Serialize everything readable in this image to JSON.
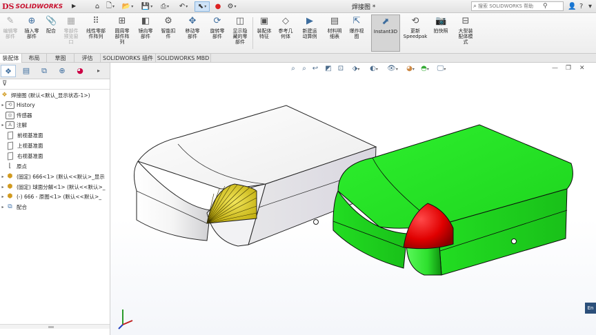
{
  "app": {
    "brand_ds": "DS",
    "brand_name": "SOLIDWORKS",
    "doc_title": "焊接图 *"
  },
  "quick_access": [
    "home-icon",
    "new-icon",
    "open-icon",
    "save-icon",
    "print-icon",
    "undo-icon",
    "select-icon",
    "rebuild-icon",
    "options-icon"
  ],
  "search": {
    "placeholder": "搜索 SOLIDWORKS 帮助"
  },
  "title_right": {
    "help": "?",
    "minimize": "—",
    "close": "×"
  },
  "commands": [
    {
      "label": "编辑零\n部件",
      "icon": "edit-component-icon",
      "disabled": true
    },
    {
      "label": "插入零\n部件",
      "icon": "insert-component-icon"
    },
    {
      "label": "配合",
      "icon": "mate-icon"
    },
    {
      "label": "零部件\n预览窗\n口",
      "icon": "preview-window-icon",
      "disabled": true
    },
    {
      "label": "线性零部\n件阵列",
      "icon": "linear-pattern-icon"
    },
    {
      "label": "圆周零\n部件阵\n列",
      "icon": "circular-pattern-icon"
    },
    {
      "label": "镜向零\n部件",
      "icon": "mirror-icon"
    },
    {
      "label": "智能扣\n件",
      "icon": "smart-fastener-icon"
    },
    {
      "label": "移动零\n部件",
      "icon": "move-component-icon"
    },
    {
      "label": "旋转零\n部件",
      "icon": "rotate-component-icon"
    },
    {
      "label": "显示隐\n藏的零\n部件",
      "icon": "show-hidden-icon"
    },
    {
      "label": "装配体\n特征",
      "icon": "assembly-feature-icon"
    },
    {
      "label": "参考几\n何体",
      "icon": "reference-geometry-icon"
    },
    {
      "label": "新建运\n动算例",
      "icon": "motion-study-icon"
    },
    {
      "label": "材料明\n细表",
      "icon": "bom-icon"
    },
    {
      "label": "爆炸视\n图",
      "icon": "exploded-view-icon"
    },
    {
      "label": "Instant3D",
      "icon": "instant3d-icon",
      "active": true
    },
    {
      "label": "更新\nSpeedpak",
      "icon": "speedpak-icon"
    },
    {
      "label": "拍快照",
      "icon": "snapshot-icon"
    },
    {
      "label": "大型装\n配体模\n式",
      "icon": "large-assembly-icon"
    }
  ],
  "tabs": [
    "装配体",
    "布局",
    "草图",
    "评估",
    "SOLIDWORKS 插件",
    "SOLIDWORKS MBD"
  ],
  "active_tab": 0,
  "panel_tabs": [
    "feature-manager-icon",
    "property-manager-icon",
    "configuration-manager-icon",
    "dimxpert-icon",
    "display-manager-icon"
  ],
  "tree": [
    {
      "label": "焊接图 (默认<默认_显示状态-1>)",
      "icon": "assembly-icon",
      "expand": "",
      "indent": 0
    },
    {
      "label": "History",
      "icon": "history-icon",
      "expand": "▸",
      "indent": 1
    },
    {
      "label": "传感器",
      "icon": "sensor-icon",
      "expand": "",
      "indent": 1
    },
    {
      "label": "注解",
      "icon": "annotation-icon",
      "expand": "▸",
      "indent": 1
    },
    {
      "label": "前视基准面",
      "icon": "plane-icon",
      "expand": "",
      "indent": 1
    },
    {
      "label": "上视基准面",
      "icon": "plane-icon",
      "expand": "",
      "indent": 1
    },
    {
      "label": "右视基准面",
      "icon": "plane-icon",
      "expand": "",
      "indent": 1
    },
    {
      "label": "原点",
      "icon": "origin-icon",
      "expand": "",
      "indent": 1
    },
    {
      "label": "(固定) 666<1> (默认<<默认>_显示",
      "icon": "part-icon",
      "expand": "▸",
      "indent": 1
    },
    {
      "label": "(固定) 球面分解<1> (默认<<默认>_",
      "icon": "part-icon",
      "expand": "▸",
      "indent": 1
    },
    {
      "label": "(-) 666 - 原图<1> (默认<<默认>_",
      "icon": "part-icon",
      "expand": "▸",
      "indent": 1
    },
    {
      "label": "配合",
      "icon": "mates-icon",
      "expand": "▸",
      "indent": 1
    }
  ],
  "colors": {
    "box_left": "#f1f1f1",
    "box_left_side": "#d9d9de",
    "sphere_yellow": "#e3d11a",
    "box_right": "#22dd22",
    "box_right_dark": "#10a810",
    "sphere_red": "#e00000",
    "accent": "#3d6d9e",
    "brand": "#c8102e"
  },
  "triad_axes": [
    "x",
    "y",
    "z"
  ]
}
